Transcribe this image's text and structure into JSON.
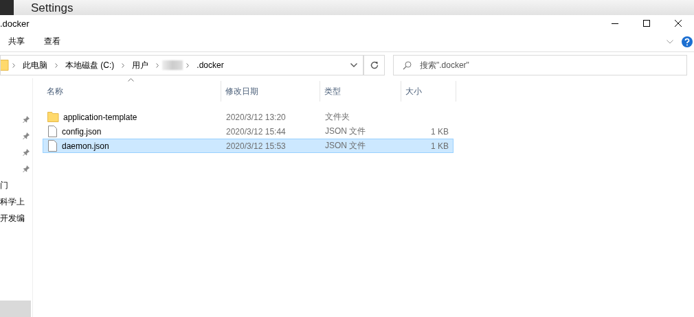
{
  "background_app": {
    "title": "Settings"
  },
  "window": {
    "title": ".docker"
  },
  "ribbon_tabs": [
    {
      "label": "共享",
      "selected": false
    },
    {
      "label": "查看",
      "selected": false
    }
  ],
  "breadcrumb": [
    {
      "label": "此电脑"
    },
    {
      "label": "本地磁盘 (C:)"
    },
    {
      "label": "用户"
    },
    {
      "kind": "redacted"
    },
    {
      "label": ".docker"
    }
  ],
  "search": {
    "placeholder": "搜索\".docker\""
  },
  "sidebar": {
    "items": [
      {
        "kind": "pinned"
      },
      {
        "kind": "pinned"
      },
      {
        "kind": "pinned"
      },
      {
        "kind": "pinned"
      },
      {
        "kind": "text",
        "label": "门"
      },
      {
        "kind": "text",
        "label": "科学上"
      },
      {
        "kind": "text",
        "label": "开发编"
      },
      {
        "kind": "blank",
        "selected": true
      }
    ]
  },
  "table": {
    "columns": [
      "名称",
      "修改日期",
      "类型",
      "大小"
    ],
    "rows": [
      {
        "kind": "folder",
        "name": "application-template",
        "date": "2020/3/12 13:20",
        "type": "文件夹",
        "size": "",
        "selected": false
      },
      {
        "kind": "file",
        "name": "config.json",
        "date": "2020/3/12 15:44",
        "type": "JSON 文件",
        "size": "1 KB",
        "selected": false
      },
      {
        "kind": "file",
        "name": "daemon.json",
        "date": "2020/3/12 15:53",
        "type": "JSON 文件",
        "size": "1 KB",
        "selected": true
      }
    ]
  }
}
